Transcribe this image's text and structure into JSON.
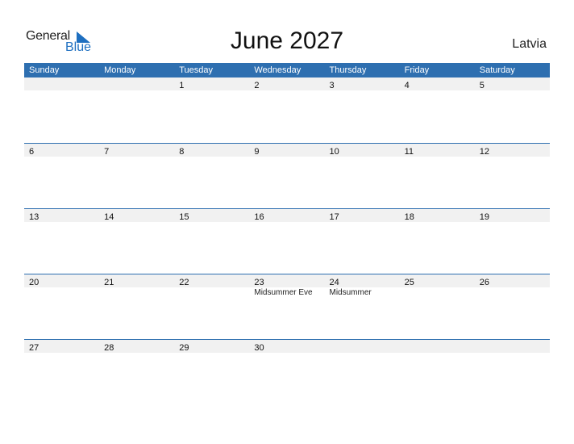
{
  "logo": {
    "line1": "General",
    "line2": "Blue",
    "accent": "#1e6fc0"
  },
  "title": "June 2027",
  "country": "Latvia",
  "colors": {
    "header_bg": "#2e6fb0",
    "strip_bg": "#f1f1f1"
  },
  "weekdays": [
    "Sunday",
    "Monday",
    "Tuesday",
    "Wednesday",
    "Thursday",
    "Friday",
    "Saturday"
  ],
  "weeks": [
    {
      "days": [
        {
          "num": "",
          "event": ""
        },
        {
          "num": "",
          "event": ""
        },
        {
          "num": "1",
          "event": ""
        },
        {
          "num": "2",
          "event": ""
        },
        {
          "num": "3",
          "event": ""
        },
        {
          "num": "4",
          "event": ""
        },
        {
          "num": "5",
          "event": ""
        }
      ]
    },
    {
      "days": [
        {
          "num": "6",
          "event": ""
        },
        {
          "num": "7",
          "event": ""
        },
        {
          "num": "8",
          "event": ""
        },
        {
          "num": "9",
          "event": ""
        },
        {
          "num": "10",
          "event": ""
        },
        {
          "num": "11",
          "event": ""
        },
        {
          "num": "12",
          "event": ""
        }
      ]
    },
    {
      "days": [
        {
          "num": "13",
          "event": ""
        },
        {
          "num": "14",
          "event": ""
        },
        {
          "num": "15",
          "event": ""
        },
        {
          "num": "16",
          "event": ""
        },
        {
          "num": "17",
          "event": ""
        },
        {
          "num": "18",
          "event": ""
        },
        {
          "num": "19",
          "event": ""
        }
      ]
    },
    {
      "days": [
        {
          "num": "20",
          "event": ""
        },
        {
          "num": "21",
          "event": ""
        },
        {
          "num": "22",
          "event": ""
        },
        {
          "num": "23",
          "event": "Midsummer Eve"
        },
        {
          "num": "24",
          "event": "Midsummer"
        },
        {
          "num": "25",
          "event": ""
        },
        {
          "num": "26",
          "event": ""
        }
      ]
    },
    {
      "days": [
        {
          "num": "27",
          "event": ""
        },
        {
          "num": "28",
          "event": ""
        },
        {
          "num": "29",
          "event": ""
        },
        {
          "num": "30",
          "event": ""
        },
        {
          "num": "",
          "event": ""
        },
        {
          "num": "",
          "event": ""
        },
        {
          "num": "",
          "event": ""
        }
      ]
    }
  ]
}
